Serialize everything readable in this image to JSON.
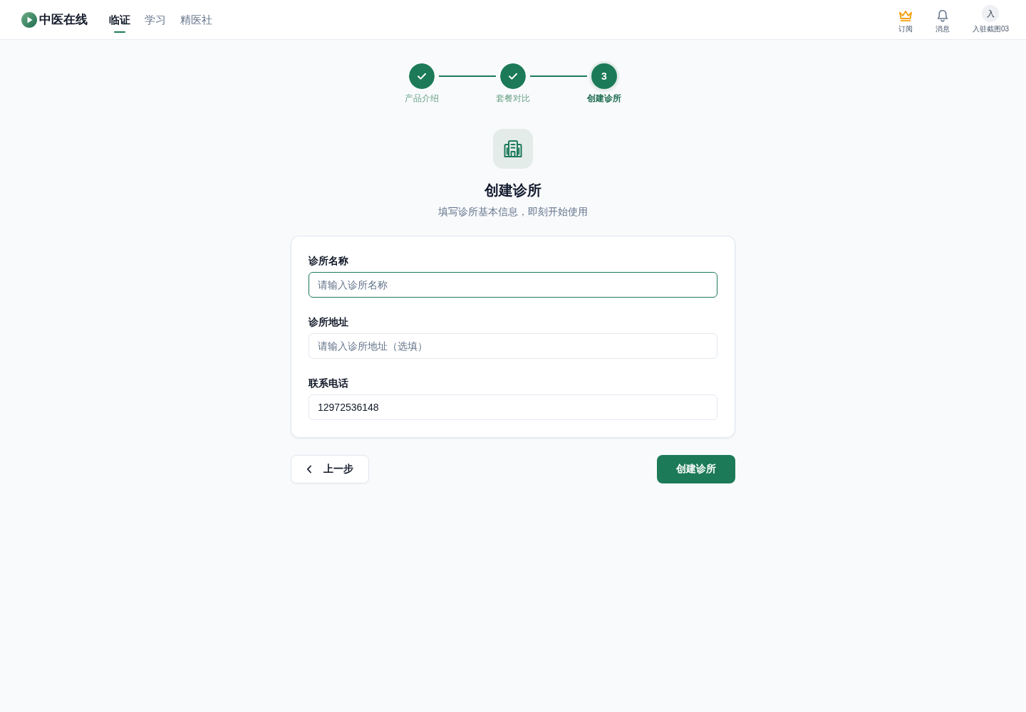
{
  "header": {
    "brand": "中医在线",
    "nav": [
      {
        "label": "临证",
        "selected": true
      },
      {
        "label": "学习",
        "selected": false
      },
      {
        "label": "精医社",
        "selected": false
      }
    ],
    "actions": [
      {
        "kind": "subscribe",
        "label": "订阅"
      },
      {
        "kind": "messages",
        "label": "消息"
      },
      {
        "kind": "account",
        "avatar": "入",
        "label": "入驻截图03"
      }
    ]
  },
  "steps": [
    {
      "label": "产品介绍",
      "done": true,
      "selected": false
    },
    {
      "label": "套餐对比",
      "done": true,
      "selected": false
    },
    {
      "label": "创建诊所",
      "number": "3",
      "done": false,
      "selected": true
    }
  ],
  "intro": {
    "title": "创建诊所",
    "subtitle": "填写诊所基本信息，即刻开始使用"
  },
  "form": {
    "fields": [
      {
        "label": "诊所名称",
        "placeholder": "请输入诊所名称",
        "focused": true
      },
      {
        "label": "诊所地址",
        "placeholder": "请输入诊所地址（选填）",
        "focused": false
      },
      {
        "label": "联系电话",
        "value": "12972536148",
        "focused": false
      }
    ]
  },
  "buttons": [
    {
      "kind": "back",
      "label": "上一步"
    },
    {
      "kind": "primary",
      "label": "创建诊所"
    }
  ]
}
